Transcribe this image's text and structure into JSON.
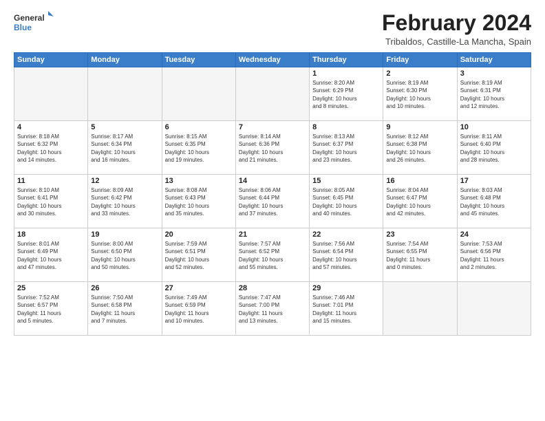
{
  "logo": {
    "general": "General",
    "blue": "Blue"
  },
  "header": {
    "month": "February 2024",
    "location": "Tribaldos, Castille-La Mancha, Spain"
  },
  "weekdays": [
    "Sunday",
    "Monday",
    "Tuesday",
    "Wednesday",
    "Thursday",
    "Friday",
    "Saturday"
  ],
  "weeks": [
    [
      {
        "day": "",
        "info": ""
      },
      {
        "day": "",
        "info": ""
      },
      {
        "day": "",
        "info": ""
      },
      {
        "day": "",
        "info": ""
      },
      {
        "day": "1",
        "info": "Sunrise: 8:20 AM\nSunset: 6:29 PM\nDaylight: 10 hours\nand 8 minutes."
      },
      {
        "day": "2",
        "info": "Sunrise: 8:19 AM\nSunset: 6:30 PM\nDaylight: 10 hours\nand 10 minutes."
      },
      {
        "day": "3",
        "info": "Sunrise: 8:19 AM\nSunset: 6:31 PM\nDaylight: 10 hours\nand 12 minutes."
      }
    ],
    [
      {
        "day": "4",
        "info": "Sunrise: 8:18 AM\nSunset: 6:32 PM\nDaylight: 10 hours\nand 14 minutes."
      },
      {
        "day": "5",
        "info": "Sunrise: 8:17 AM\nSunset: 6:34 PM\nDaylight: 10 hours\nand 16 minutes."
      },
      {
        "day": "6",
        "info": "Sunrise: 8:15 AM\nSunset: 6:35 PM\nDaylight: 10 hours\nand 19 minutes."
      },
      {
        "day": "7",
        "info": "Sunrise: 8:14 AM\nSunset: 6:36 PM\nDaylight: 10 hours\nand 21 minutes."
      },
      {
        "day": "8",
        "info": "Sunrise: 8:13 AM\nSunset: 6:37 PM\nDaylight: 10 hours\nand 23 minutes."
      },
      {
        "day": "9",
        "info": "Sunrise: 8:12 AM\nSunset: 6:38 PM\nDaylight: 10 hours\nand 26 minutes."
      },
      {
        "day": "10",
        "info": "Sunrise: 8:11 AM\nSunset: 6:40 PM\nDaylight: 10 hours\nand 28 minutes."
      }
    ],
    [
      {
        "day": "11",
        "info": "Sunrise: 8:10 AM\nSunset: 6:41 PM\nDaylight: 10 hours\nand 30 minutes."
      },
      {
        "day": "12",
        "info": "Sunrise: 8:09 AM\nSunset: 6:42 PM\nDaylight: 10 hours\nand 33 minutes."
      },
      {
        "day": "13",
        "info": "Sunrise: 8:08 AM\nSunset: 6:43 PM\nDaylight: 10 hours\nand 35 minutes."
      },
      {
        "day": "14",
        "info": "Sunrise: 8:06 AM\nSunset: 6:44 PM\nDaylight: 10 hours\nand 37 minutes."
      },
      {
        "day": "15",
        "info": "Sunrise: 8:05 AM\nSunset: 6:45 PM\nDaylight: 10 hours\nand 40 minutes."
      },
      {
        "day": "16",
        "info": "Sunrise: 8:04 AM\nSunset: 6:47 PM\nDaylight: 10 hours\nand 42 minutes."
      },
      {
        "day": "17",
        "info": "Sunrise: 8:03 AM\nSunset: 6:48 PM\nDaylight: 10 hours\nand 45 minutes."
      }
    ],
    [
      {
        "day": "18",
        "info": "Sunrise: 8:01 AM\nSunset: 6:49 PM\nDaylight: 10 hours\nand 47 minutes."
      },
      {
        "day": "19",
        "info": "Sunrise: 8:00 AM\nSunset: 6:50 PM\nDaylight: 10 hours\nand 50 minutes."
      },
      {
        "day": "20",
        "info": "Sunrise: 7:59 AM\nSunset: 6:51 PM\nDaylight: 10 hours\nand 52 minutes."
      },
      {
        "day": "21",
        "info": "Sunrise: 7:57 AM\nSunset: 6:52 PM\nDaylight: 10 hours\nand 55 minutes."
      },
      {
        "day": "22",
        "info": "Sunrise: 7:56 AM\nSunset: 6:54 PM\nDaylight: 10 hours\nand 57 minutes."
      },
      {
        "day": "23",
        "info": "Sunrise: 7:54 AM\nSunset: 6:55 PM\nDaylight: 11 hours\nand 0 minutes."
      },
      {
        "day": "24",
        "info": "Sunrise: 7:53 AM\nSunset: 6:56 PM\nDaylight: 11 hours\nand 2 minutes."
      }
    ],
    [
      {
        "day": "25",
        "info": "Sunrise: 7:52 AM\nSunset: 6:57 PM\nDaylight: 11 hours\nand 5 minutes."
      },
      {
        "day": "26",
        "info": "Sunrise: 7:50 AM\nSunset: 6:58 PM\nDaylight: 11 hours\nand 7 minutes."
      },
      {
        "day": "27",
        "info": "Sunrise: 7:49 AM\nSunset: 6:59 PM\nDaylight: 11 hours\nand 10 minutes."
      },
      {
        "day": "28",
        "info": "Sunrise: 7:47 AM\nSunset: 7:00 PM\nDaylight: 11 hours\nand 13 minutes."
      },
      {
        "day": "29",
        "info": "Sunrise: 7:46 AM\nSunset: 7:01 PM\nDaylight: 11 hours\nand 15 minutes."
      },
      {
        "day": "",
        "info": ""
      },
      {
        "day": "",
        "info": ""
      }
    ]
  ]
}
